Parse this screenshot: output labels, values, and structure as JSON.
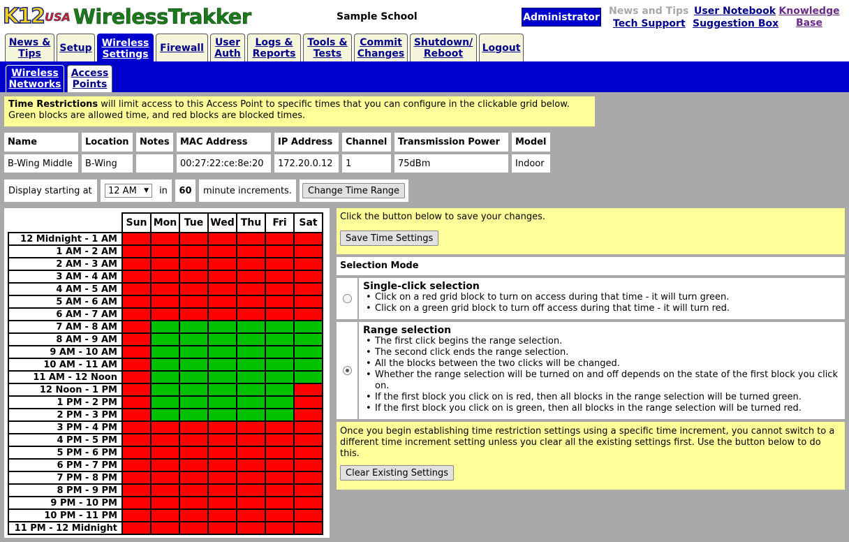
{
  "header": {
    "logo_k12": "K12",
    "logo_usa": "USA",
    "logo_name": "WirelessTrakker",
    "school": "Sample School",
    "role": "Administrator",
    "news_tips": "News and Tips",
    "tech_support": "Tech Support",
    "user_notebook": "User Notebook",
    "suggestion_box": "Suggestion Box",
    "knowledge_base": "Knowledge Base"
  },
  "tabs": [
    {
      "line1": "News &",
      "line2": "Tips"
    },
    {
      "line1": "Setup",
      "line2": ""
    },
    {
      "line1": "Wireless",
      "line2": "Settings"
    },
    {
      "line1": "Firewall",
      "line2": ""
    },
    {
      "line1": "User",
      "line2": "Auth"
    },
    {
      "line1": "Logs &",
      "line2": "Reports"
    },
    {
      "line1": "Tools &",
      "line2": "Tests"
    },
    {
      "line1": "Commit",
      "line2": "Changes"
    },
    {
      "line1": "Shutdown/",
      "line2": "Reboot"
    },
    {
      "line1": "Logout",
      "line2": ""
    }
  ],
  "subtabs": [
    {
      "line1": "Wireless",
      "line2": "Networks"
    },
    {
      "line1": "Access",
      "line2": "Points"
    }
  ],
  "notice": {
    "bold": "Time Restrictions",
    "text1": " will limit access to this Access Point to specific times that you can configure in the clickable grid below.",
    "text2": "Green blocks are allowed time, and red blocks are blocked times."
  },
  "ap_table": {
    "headers": [
      "Name",
      "Location",
      "Notes",
      "MAC Address",
      "IP Address",
      "Channel",
      "Transmission Power",
      "Model"
    ],
    "values": [
      "B-Wing Middle",
      "B-Wing",
      "",
      "00:27:22:ce:8e:20",
      "172.20.0.12",
      "1",
      "75dBm",
      "Indoor"
    ]
  },
  "display": {
    "label": "Display starting at",
    "start_value": "12 AM",
    "in_label": "in",
    "increment": "60",
    "increment_label": "minute increments.",
    "change_button": "Change Time Range"
  },
  "grid": {
    "days": [
      "Sun",
      "Mon",
      "Tue",
      "Wed",
      "Thu",
      "Fri",
      "Sat"
    ],
    "rows": [
      {
        "label": "12 Midnight - 1 AM",
        "cells": [
          0,
          0,
          0,
          0,
          0,
          0,
          0
        ]
      },
      {
        "label": "1 AM - 2 AM",
        "cells": [
          0,
          0,
          0,
          0,
          0,
          0,
          0
        ]
      },
      {
        "label": "2 AM - 3 AM",
        "cells": [
          0,
          0,
          0,
          0,
          0,
          0,
          0
        ]
      },
      {
        "label": "3 AM - 4 AM",
        "cells": [
          0,
          0,
          0,
          0,
          0,
          0,
          0
        ]
      },
      {
        "label": "4 AM - 5 AM",
        "cells": [
          0,
          0,
          0,
          0,
          0,
          0,
          0
        ]
      },
      {
        "label": "5 AM - 6 AM",
        "cells": [
          0,
          0,
          0,
          0,
          0,
          0,
          0
        ]
      },
      {
        "label": "6 AM - 7 AM",
        "cells": [
          0,
          0,
          0,
          0,
          0,
          0,
          0
        ]
      },
      {
        "label": "7 AM - 8 AM",
        "cells": [
          0,
          1,
          1,
          1,
          1,
          1,
          1
        ]
      },
      {
        "label": "8 AM - 9 AM",
        "cells": [
          0,
          1,
          1,
          1,
          1,
          1,
          1
        ]
      },
      {
        "label": "9 AM - 10 AM",
        "cells": [
          0,
          1,
          1,
          1,
          1,
          1,
          1
        ]
      },
      {
        "label": "10 AM - 11 AM",
        "cells": [
          0,
          1,
          1,
          1,
          1,
          1,
          1
        ]
      },
      {
        "label": "11 AM - 12 Noon",
        "cells": [
          0,
          1,
          1,
          1,
          1,
          1,
          1
        ]
      },
      {
        "label": "12 Noon - 1 PM",
        "cells": [
          0,
          1,
          1,
          1,
          1,
          1,
          0
        ]
      },
      {
        "label": "1 PM - 2 PM",
        "cells": [
          0,
          1,
          1,
          1,
          1,
          1,
          0
        ]
      },
      {
        "label": "2 PM - 3 PM",
        "cells": [
          0,
          1,
          1,
          1,
          1,
          1,
          0
        ]
      },
      {
        "label": "3 PM - 4 PM",
        "cells": [
          0,
          0,
          0,
          0,
          0,
          0,
          0
        ]
      },
      {
        "label": "4 PM - 5 PM",
        "cells": [
          0,
          0,
          0,
          0,
          0,
          0,
          0
        ]
      },
      {
        "label": "5 PM - 6 PM",
        "cells": [
          0,
          0,
          0,
          0,
          0,
          0,
          0
        ]
      },
      {
        "label": "6 PM - 7 PM",
        "cells": [
          0,
          0,
          0,
          0,
          0,
          0,
          0
        ]
      },
      {
        "label": "7 PM - 8 PM",
        "cells": [
          0,
          0,
          0,
          0,
          0,
          0,
          0
        ]
      },
      {
        "label": "8 PM - 9 PM",
        "cells": [
          0,
          0,
          0,
          0,
          0,
          0,
          0
        ]
      },
      {
        "label": "9 PM - 10 PM",
        "cells": [
          0,
          0,
          0,
          0,
          0,
          0,
          0
        ]
      },
      {
        "label": "10 PM - 11 PM",
        "cells": [
          0,
          0,
          0,
          0,
          0,
          0,
          0
        ]
      },
      {
        "label": "11 PM - 12 Midnight",
        "cells": [
          0,
          0,
          0,
          0,
          0,
          0,
          0
        ]
      }
    ],
    "colors": {
      "allowed": "#00c000",
      "blocked": "#ff0000"
    }
  },
  "save": {
    "text": "Click the button below to save your changes.",
    "button": "Save Time Settings"
  },
  "selection_mode": {
    "title": "Selection Mode",
    "single": {
      "title": "Single-click selection",
      "checked": false,
      "bullets": [
        "Click on a red grid block to turn on access during that time - it will turn green.",
        "Click on a green grid block to turn off access during that time - it will turn red."
      ]
    },
    "range": {
      "title": "Range selection",
      "checked": true,
      "bullets": [
        "The first click begins the range selection.",
        "The second click ends the range selection.",
        "All the blocks between the two clicks will be changed.",
        "Whether the range selection will be turned on and off depends on the state of the first block you click on.",
        "If the first block you click on is red, then all blocks in the range selection will be turned green.",
        "If the first block you click on is green, then all blocks in the range selection will be turned red."
      ]
    }
  },
  "clear": {
    "text": "Once you begin establishing time restriction settings using a specific time increment, you cannot switch to a different time increment setting unless you clear all the existing settings first. Use the button below to do this.",
    "button": "Clear Existing Settings"
  },
  "colors": {
    "accent_blue": "#0000cc",
    "notice_yellow": "#ffff99",
    "background_gray": "#a9a9a9"
  }
}
